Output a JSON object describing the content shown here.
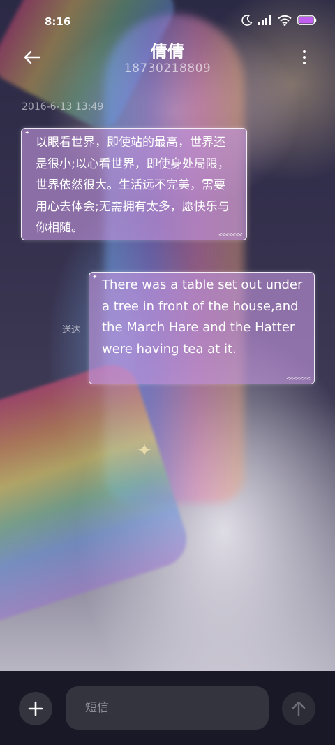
{
  "status_bar": {
    "time": "8:16",
    "icons": [
      "moon-icon",
      "signal-icon",
      "wifi-icon",
      "battery-icon"
    ],
    "battery_color": "#c05ff0"
  },
  "header": {
    "back_icon": "back-arrow-icon",
    "contact_name": "倩倩",
    "contact_number": "18730218809",
    "more_icon": "more-vertical-icon"
  },
  "conversation": {
    "timestamp": "2016-6-13 13:49",
    "incoming_message": "以眼看世界，即使站的最高，世界还是很小;以心看世界，即使身处局限，世界依然很大。生活远不完美，需要用心去体会;无需拥有太多，愿快乐与你相随。",
    "outgoing_message": "There was a table set out under a tree in front of the house,and the March Hare and the Hatter were having tea at it.",
    "outgoing_status": "送达",
    "bubble_color": "#c496de"
  },
  "composer": {
    "add_icon": "plus-icon",
    "input_placeholder": "短信",
    "input_value": "",
    "send_icon": "send-arrow-up-icon"
  }
}
